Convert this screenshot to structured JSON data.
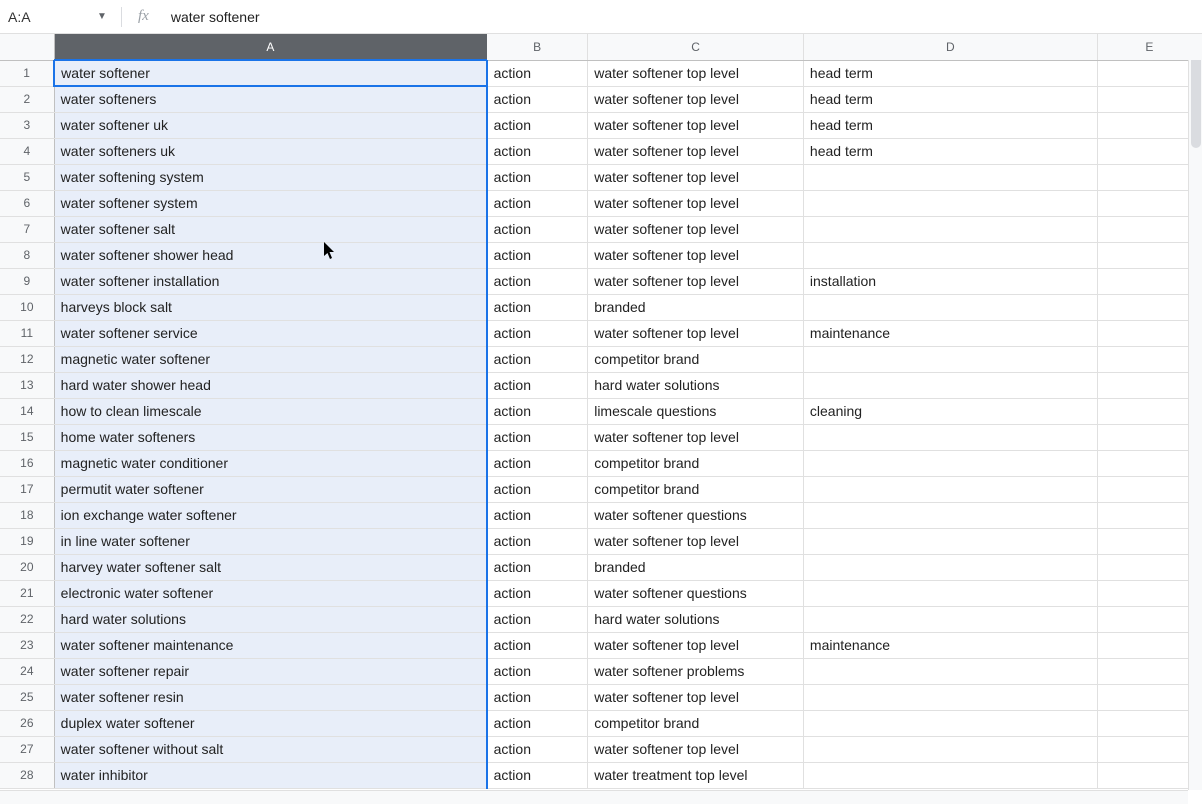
{
  "name_box": "A:A",
  "fx_label": "fx",
  "formula_bar": "water softener",
  "columns": [
    "A",
    "B",
    "C",
    "D",
    "E"
  ],
  "selected_column_index": 0,
  "rows": [
    {
      "n": "1",
      "a": "water softener",
      "b": "action",
      "c": "water softener top level",
      "d": "head term",
      "e": ""
    },
    {
      "n": "2",
      "a": "water softeners",
      "b": "action",
      "c": "water softener top level",
      "d": "head term",
      "e": ""
    },
    {
      "n": "3",
      "a": "water softener uk",
      "b": "action",
      "c": "water softener top level",
      "d": "head term",
      "e": ""
    },
    {
      "n": "4",
      "a": "water softeners uk",
      "b": "action",
      "c": "water softener top level",
      "d": "head term",
      "e": ""
    },
    {
      "n": "5",
      "a": "water softening system",
      "b": "action",
      "c": "water softener top level",
      "d": "",
      "e": ""
    },
    {
      "n": "6",
      "a": "water softener system",
      "b": "action",
      "c": "water softener top level",
      "d": "",
      "e": ""
    },
    {
      "n": "7",
      "a": "water softener salt",
      "b": "action",
      "c": "water softener top level",
      "d": "",
      "e": ""
    },
    {
      "n": "8",
      "a": "water softener shower head",
      "b": "action",
      "c": "water softener top level",
      "d": "",
      "e": ""
    },
    {
      "n": "9",
      "a": "water softener installation",
      "b": "action",
      "c": "water softener top level",
      "d": "installation",
      "e": ""
    },
    {
      "n": "10",
      "a": "harveys block salt",
      "b": "action",
      "c": "branded",
      "d": "",
      "e": ""
    },
    {
      "n": "11",
      "a": "water softener service",
      "b": "action",
      "c": "water softener top level",
      "d": "maintenance",
      "e": ""
    },
    {
      "n": "12",
      "a": "magnetic water softener",
      "b": "action",
      "c": "competitor brand",
      "d": "",
      "e": ""
    },
    {
      "n": "13",
      "a": "hard water shower head",
      "b": "action",
      "c": "hard water solutions",
      "d": "",
      "e": ""
    },
    {
      "n": "14",
      "a": "how to clean limescale",
      "b": "action",
      "c": "limescale questions",
      "d": "cleaning",
      "e": ""
    },
    {
      "n": "15",
      "a": "home water softeners",
      "b": "action",
      "c": "water softener top level",
      "d": "",
      "e": ""
    },
    {
      "n": "16",
      "a": "magnetic water conditioner",
      "b": "action",
      "c": "competitor brand",
      "d": "",
      "e": ""
    },
    {
      "n": "17",
      "a": "permutit water softener",
      "b": "action",
      "c": "competitor brand",
      "d": "",
      "e": ""
    },
    {
      "n": "18",
      "a": "ion exchange water softener",
      "b": "action",
      "c": "water softener questions",
      "d": "",
      "e": ""
    },
    {
      "n": "19",
      "a": "in line water softener",
      "b": "action",
      "c": "water softener top level",
      "d": "",
      "e": ""
    },
    {
      "n": "20",
      "a": "harvey water softener salt",
      "b": "action",
      "c": "branded",
      "d": "",
      "e": ""
    },
    {
      "n": "21",
      "a": "electronic water softener",
      "b": "action",
      "c": "water softener questions",
      "d": "",
      "e": ""
    },
    {
      "n": "22",
      "a": "hard water solutions",
      "b": "action",
      "c": "hard water solutions",
      "d": "",
      "e": ""
    },
    {
      "n": "23",
      "a": "water softener maintenance",
      "b": "action",
      "c": "water softener top level",
      "d": "maintenance",
      "e": ""
    },
    {
      "n": "24",
      "a": "water softener repair",
      "b": "action",
      "c": "water softener problems",
      "d": "",
      "e": ""
    },
    {
      "n": "25",
      "a": "water softener resin",
      "b": "action",
      "c": "water softener top level",
      "d": "",
      "e": ""
    },
    {
      "n": "26",
      "a": "duplex water softener",
      "b": "action",
      "c": "competitor brand",
      "d": "",
      "e": ""
    },
    {
      "n": "27",
      "a": "water softener without salt",
      "b": "action",
      "c": "water softener top level",
      "d": "",
      "e": ""
    },
    {
      "n": "28",
      "a": "water inhibitor",
      "b": "action",
      "c": "water treatment top level",
      "d": "",
      "e": ""
    }
  ]
}
